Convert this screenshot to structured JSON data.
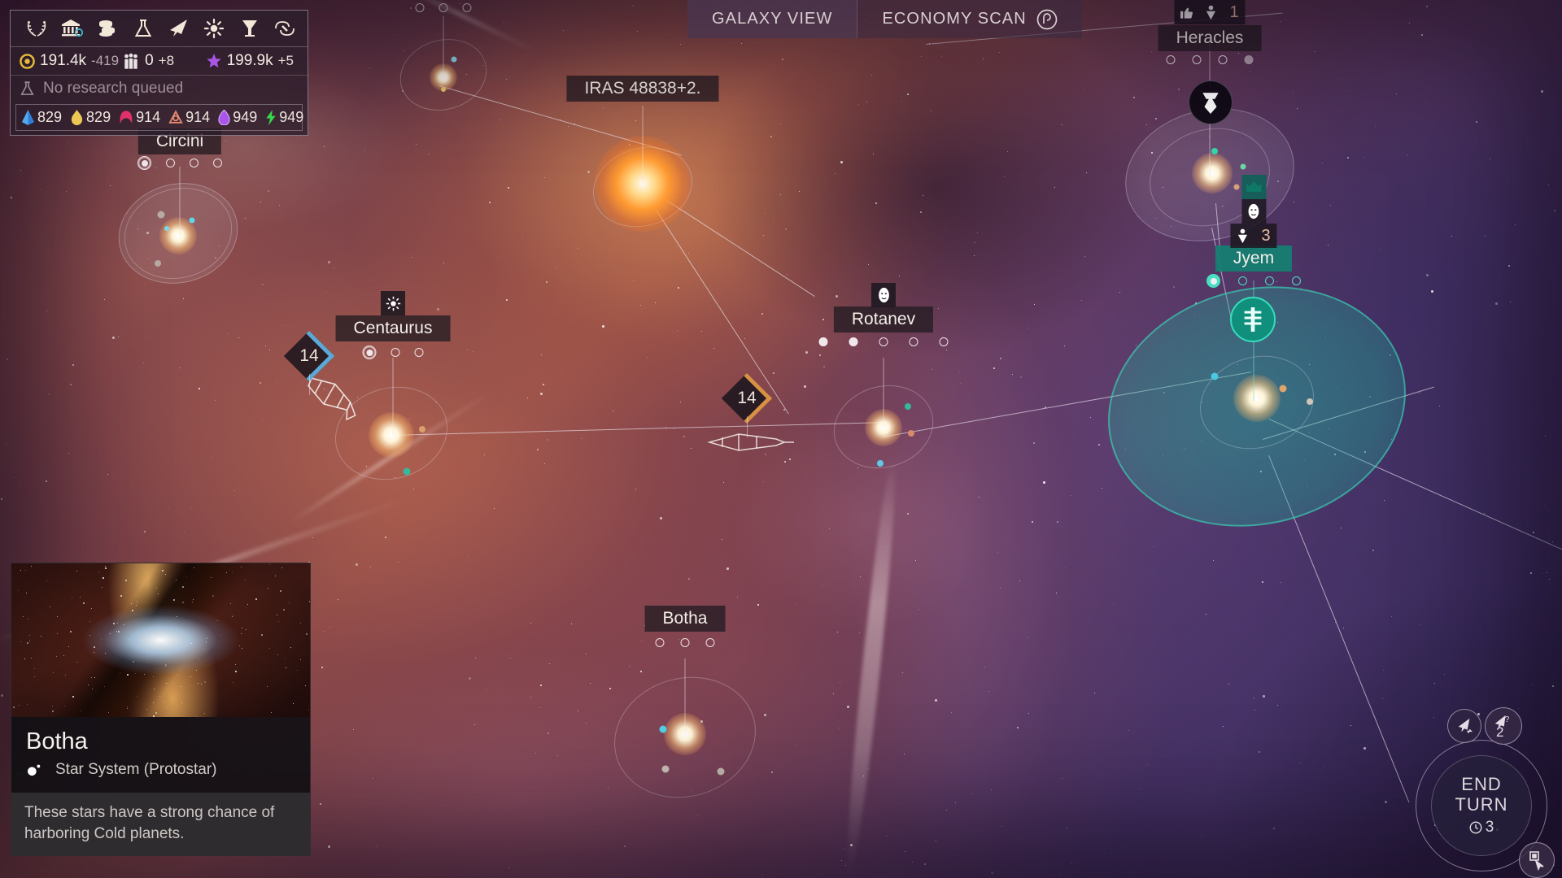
{
  "hud": {
    "toolbar_icons": [
      {
        "name": "laurel-empire-icon",
        "label": "Empire"
      },
      {
        "name": "senate-icon",
        "label": "Senate"
      },
      {
        "name": "coins-treasury-icon",
        "label": "Treasury"
      },
      {
        "name": "research-flask-icon",
        "label": "Research"
      },
      {
        "name": "fleet-arrow-icon",
        "label": "Fleets"
      },
      {
        "name": "star-sun-icon",
        "label": "Systems"
      },
      {
        "name": "hourglass-icon",
        "label": "Quests"
      },
      {
        "name": "diplomacy-handshake-icon",
        "label": "Diplomacy"
      }
    ],
    "dust": {
      "icon": "dust-icon",
      "value": "191.4k",
      "delta": "-419"
    },
    "population": {
      "icon": "population-icon",
      "value": "0",
      "delta": "+8"
    },
    "influence": {
      "icon": "influence-star-icon",
      "value": "199.9k",
      "delta": "+5"
    },
    "research_status": "No research queued",
    "research_icon": "research-flask-icon",
    "resources": [
      {
        "name": "titanium",
        "icon": "titanium-icon",
        "value": "829",
        "color": "#2f8fdd"
      },
      {
        "name": "hyperium",
        "icon": "hyperium-icon",
        "value": "829",
        "color": "#e8c65a"
      },
      {
        "name": "adamantian",
        "icon": "adamantian-icon",
        "value": "914",
        "color": "#e2316a"
      },
      {
        "name": "orichalcix",
        "icon": "orichalcix-icon",
        "value": "914",
        "color": "#e58a73"
      },
      {
        "name": "quadrinix",
        "icon": "quadrinix-icon",
        "value": "949",
        "color": "#a855e8"
      },
      {
        "name": "antimatter",
        "icon": "antimatter-icon",
        "value": "949",
        "color": "#37d64a"
      }
    ]
  },
  "topnav": {
    "tabs": [
      {
        "name": "galaxy-view",
        "label": "GALAXY VIEW",
        "active": true,
        "icon": null
      },
      {
        "name": "economy-scan",
        "label": "ECONOMY SCAN",
        "active": false,
        "icon": "scan-target-icon"
      }
    ]
  },
  "map": {
    "systems": [
      {
        "id": "circini",
        "label": "Circini",
        "owned": false,
        "planets": [
          "ring",
          "open",
          "open",
          "open"
        ]
      },
      {
        "id": "iras",
        "label": "IRAS 48838+2.",
        "owned": false,
        "planets": [
          "open",
          "open",
          "open"
        ]
      },
      {
        "id": "centaurus",
        "label": "Centaurus",
        "owned": false,
        "planets": [
          "ring",
          "open",
          "open"
        ],
        "badge": "star-sun-icon"
      },
      {
        "id": "rotanev",
        "label": "Rotanev",
        "owned": false,
        "planets": [
          "filled",
          "filled",
          "open",
          "open",
          "open"
        ],
        "badge": "minor-faction-icon"
      },
      {
        "id": "botha",
        "label": "Botha",
        "owned": false,
        "planets": [
          "open",
          "open",
          "open"
        ]
      },
      {
        "id": "heracles",
        "label": "Heracles",
        "owned": false,
        "planets": [
          "open",
          "open",
          "open",
          "filled"
        ],
        "badges": [
          {
            "icon": "thumbs-up-icon"
          },
          {
            "icon": "colonize-icon",
            "count": "1"
          }
        ]
      },
      {
        "id": "jyem",
        "label": "Jyem",
        "owned": true,
        "planets": [
          "teal-filled",
          "open",
          "open",
          "open"
        ],
        "badges": [
          {
            "icon": "crown-icon"
          },
          {
            "icon": "minor-faction-icon"
          },
          {
            "icon": "colonize-icon",
            "count": "3"
          }
        ]
      }
    ],
    "fleets": [
      {
        "id": "fleet-centaurus",
        "count": "14",
        "accent": "#5ba9d6"
      },
      {
        "id": "fleet-rotanev",
        "count": "14",
        "accent": "#d79044"
      }
    ]
  },
  "infopanel": {
    "title": "Botha",
    "type_icon": "star-system-icon",
    "type_label": "Star System (Protostar)",
    "description": "These stars have a strong chance of harboring Cold planets."
  },
  "endturn": {
    "line1": "END",
    "line2": "TURN",
    "timer_icon": "clock-icon",
    "timer": "3",
    "buttons": [
      {
        "name": "next-idle-fleet-button",
        "icon": "fleet-next-icon"
      },
      {
        "name": "unassigned-fleets-button",
        "icon": "fleet-question-icon",
        "count": "2"
      },
      {
        "name": "selection-mode-button",
        "icon": "cursor-select-icon"
      }
    ]
  }
}
